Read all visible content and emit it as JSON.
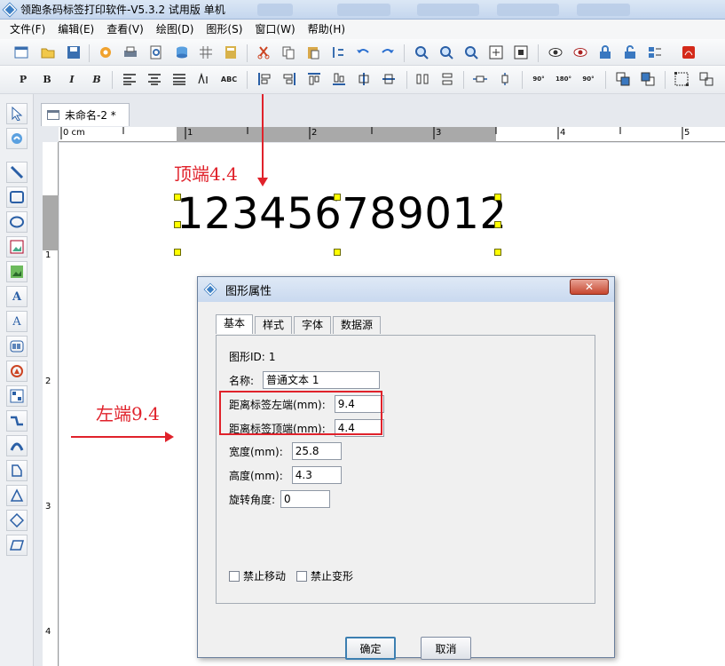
{
  "window": {
    "title": "领跑条码标签打印软件-V5.3.2 试用版 单机"
  },
  "menu": [
    "文件(F)",
    "编辑(E)",
    "查看(V)",
    "绘图(D)",
    "图形(S)",
    "窗口(W)",
    "帮助(H)"
  ],
  "toolbar2_labels": {
    "p": "P",
    "b": "B",
    "i": "I",
    "b2": "B",
    "abc": "ABC",
    "r90": "90°",
    "r180": "180°",
    "r90b": "90°"
  },
  "document": {
    "tab_label": "未命名-2 *",
    "ruler_h": [
      "0 cm",
      "1",
      "2",
      "3",
      "4",
      "5"
    ],
    "ruler_v": [
      "1",
      "2",
      "3",
      "4"
    ],
    "barcode_text": "123456789012"
  },
  "annotations": {
    "top": "顶端4.4",
    "left": "左端9.4"
  },
  "dialog": {
    "title": "图形属性",
    "close": "✕",
    "tabs": [
      "基本",
      "样式",
      "字体",
      "数据源"
    ],
    "id_label": "图形ID:",
    "id_value": "1",
    "name_label": "名称:",
    "name_value": "普通文本 1",
    "left_label": "距离标签左端(mm):",
    "left_value": "9.4",
    "top_label": "距离标签顶端(mm):",
    "top_value": "4.4",
    "width_label": "宽度(mm):",
    "width_value": "25.8",
    "height_label": "高度(mm):",
    "height_value": "4.3",
    "rotate_label": "旋转角度:",
    "rotate_value": "0",
    "no_move": "禁止移动",
    "no_deform": "禁止变形",
    "ok": "确定",
    "cancel": "取消"
  },
  "colors": {
    "annotation": "#e0222b",
    "handle": "#ffff00"
  }
}
